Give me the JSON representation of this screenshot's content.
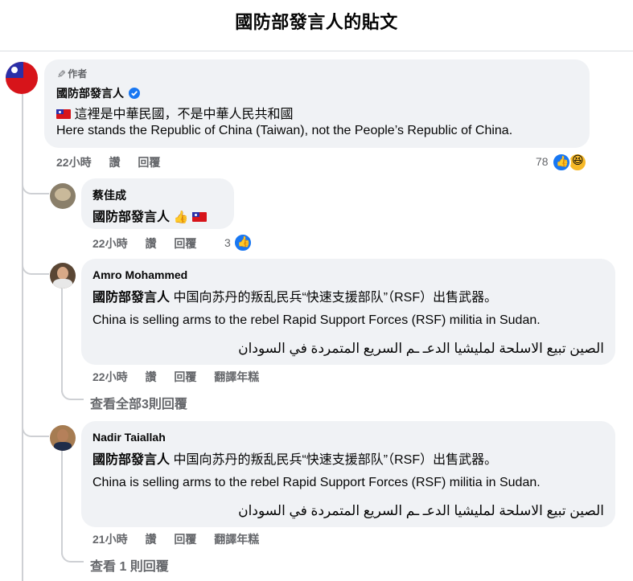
{
  "header": {
    "title": "國防部發言人的貼文"
  },
  "comments": [
    {
      "author_badge": "作者",
      "author": "國防部發言人",
      "text_zh": "這裡是中華民國，不是中華人民共和國",
      "text_en": "Here stands the Republic of China (Taiwan), not the People’s Republic of China.",
      "time": "22小時",
      "like": "讚",
      "reply": "回覆",
      "reactions": "78"
    }
  ],
  "replies": [
    {
      "author": "蔡佳成",
      "mention": "國防部發言人",
      "time": "22小時",
      "like": "讚",
      "reply": "回覆",
      "reactions": "3"
    },
    {
      "author": "Amro Mohammed",
      "mention": "國防部發言人",
      "text_zh": "中国向苏丹的叛乱民兵“快速支援部队”（RSF）出售武器。",
      "text_en": "China is selling arms to the rebel Rapid Support Forces (RSF) militia in Sudan.",
      "text_ar": "الصين تبيع الاسلحة لمليشيا الدعـ ـم السريع المتمردة في السودان",
      "time": "22小時",
      "like": "讚",
      "reply": "回覆",
      "translate": "翻譯年糕",
      "view_more": "查看全部3則回覆"
    },
    {
      "author": "Nadir Taiallah",
      "mention": "國防部發言人",
      "text_zh": "中国向苏丹的叛乱民兵“快速支援部队”（RSF）出售武器。",
      "text_en": "China is selling arms to the rebel Rapid Support Forces (RSF) militia in Sudan.",
      "text_ar": "الصين تبيع الاسلحة لمليشيا الدعـ ـم السريع المتمردة في السودان",
      "time": "21小時",
      "like": "讚",
      "reply": "回覆",
      "translate": "翻譯年糕",
      "view_more": "查看 1 則回覆"
    }
  ],
  "colors": {
    "accent": "#1877f2",
    "muted": "#65676b",
    "bubble": "#f0f2f5"
  }
}
